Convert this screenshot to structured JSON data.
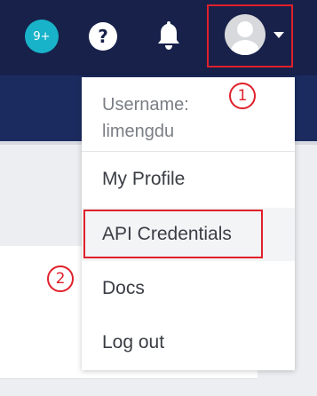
{
  "header": {
    "notification_badge": "9+",
    "help_symbol": "?",
    "icons": [
      "notification-count-icon",
      "help-icon",
      "bell-icon",
      "avatar-icon",
      "caret-down-icon"
    ]
  },
  "dropdown": {
    "username": "Username:\nlimengdu",
    "items": [
      {
        "label": "My Profile"
      },
      {
        "label": "API Credentials"
      },
      {
        "label": "Docs"
      },
      {
        "label": "Log out"
      }
    ]
  },
  "annotations": {
    "marker_1": "1",
    "marker_2": "2"
  },
  "colors": {
    "header_bg": "#17214a",
    "subheader_bg": "#1c2b5f",
    "badge_bg": "#19b3c9",
    "highlight_red": "#e0202a",
    "menu_text": "#3a3d44",
    "muted_text": "#7a7e85"
  }
}
